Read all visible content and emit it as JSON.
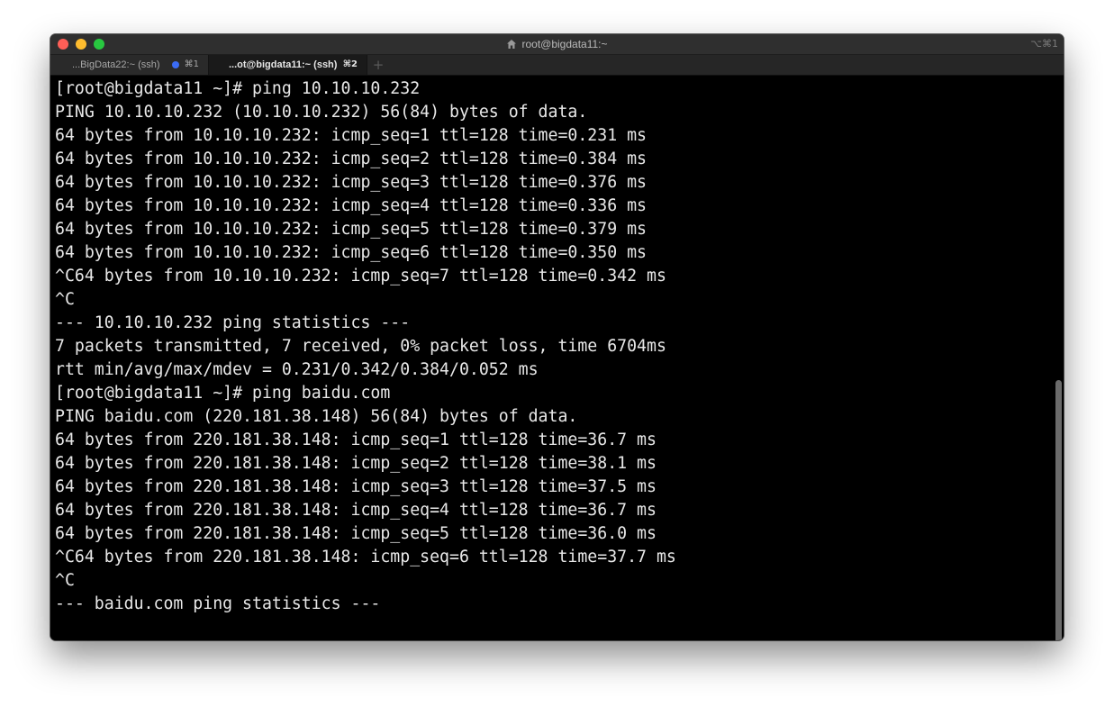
{
  "window": {
    "title": "root@bigdata11:~",
    "shortcut": "⌥⌘1"
  },
  "tabs": [
    {
      "label": "...BigData22:~ (ssh)",
      "shortcut": "⌘1",
      "active": false
    },
    {
      "label": "...ot@bigdata11:~ (ssh)",
      "shortcut": "⌘2",
      "active": true
    }
  ],
  "new_tab_label": "+",
  "terminal": {
    "lines": [
      "[root@bigdata11 ~]# ping 10.10.10.232",
      "PING 10.10.10.232 (10.10.10.232) 56(84) bytes of data.",
      "64 bytes from 10.10.10.232: icmp_seq=1 ttl=128 time=0.231 ms",
      "64 bytes from 10.10.10.232: icmp_seq=2 ttl=128 time=0.384 ms",
      "64 bytes from 10.10.10.232: icmp_seq=3 ttl=128 time=0.376 ms",
      "64 bytes from 10.10.10.232: icmp_seq=4 ttl=128 time=0.336 ms",
      "64 bytes from 10.10.10.232: icmp_seq=5 ttl=128 time=0.379 ms",
      "64 bytes from 10.10.10.232: icmp_seq=6 ttl=128 time=0.350 ms",
      "^C64 bytes from 10.10.10.232: icmp_seq=7 ttl=128 time=0.342 ms",
      "^C",
      "--- 10.10.10.232 ping statistics ---",
      "7 packets transmitted, 7 received, 0% packet loss, time 6704ms",
      "rtt min/avg/max/mdev = 0.231/0.342/0.384/0.052 ms",
      "[root@bigdata11 ~]# ping baidu.com",
      "PING baidu.com (220.181.38.148) 56(84) bytes of data.",
      "64 bytes from 220.181.38.148: icmp_seq=1 ttl=128 time=36.7 ms",
      "64 bytes from 220.181.38.148: icmp_seq=2 ttl=128 time=38.1 ms",
      "64 bytes from 220.181.38.148: icmp_seq=3 ttl=128 time=37.5 ms",
      "64 bytes from 220.181.38.148: icmp_seq=4 ttl=128 time=36.7 ms",
      "64 bytes from 220.181.38.148: icmp_seq=5 ttl=128 time=36.0 ms",
      "^C64 bytes from 220.181.38.148: icmp_seq=6 ttl=128 time=37.7 ms",
      "^C",
      "--- baidu.com ping statistics ---"
    ]
  },
  "icons": {
    "close": "close-icon",
    "minimize": "minimize-icon",
    "zoom": "zoom-icon",
    "home": "home-icon",
    "activity_dot": "activity-dot-icon"
  },
  "colors": {
    "background": "#000000",
    "text": "#e8e8e8",
    "titlebar": "#2f2f2f",
    "close": "#fe5f57",
    "minimize": "#febc2e",
    "zoom": "#28c840",
    "activity_dot": "#3b6cf5"
  }
}
